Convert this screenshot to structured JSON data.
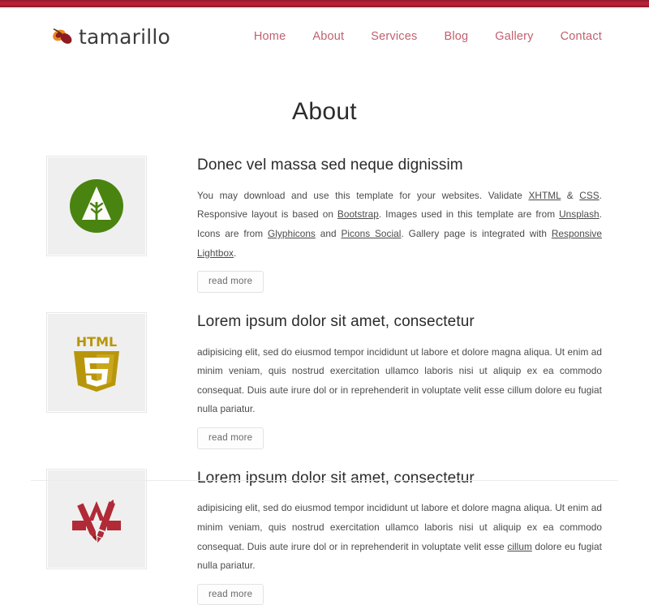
{
  "site": {
    "brand_name": "tamarillo",
    "brand_icon": "tamarillo-fruit-icon",
    "accent_color": "#c1606f",
    "topbar_color": "#a81e33",
    "background_color": "#ffffff"
  },
  "nav": {
    "items": [
      {
        "label": "Home",
        "active": false
      },
      {
        "label": "About",
        "active": true
      },
      {
        "label": "Services",
        "active": false
      },
      {
        "label": "Blog",
        "active": false
      },
      {
        "label": "Gallery",
        "active": false
      },
      {
        "label": "Contact",
        "active": false
      }
    ]
  },
  "page": {
    "title": "About"
  },
  "sections": [
    {
      "thumb_icon": "green-forest-tree-circle-icon",
      "heading": "Donec vel massa sed neque dignissim",
      "paragraph_parts": [
        {
          "text": "You may download and use this template for your websites. Validate ",
          "link": false
        },
        {
          "text": "XHTML",
          "link": true
        },
        {
          "text": " & ",
          "link": false
        },
        {
          "text": "CSS",
          "link": true
        },
        {
          "text": ". Responsive layout is based on ",
          "link": false
        },
        {
          "text": "Bootstrap",
          "link": true
        },
        {
          "text": ". Images used in this template are from ",
          "link": false
        },
        {
          "text": "Unsplash",
          "link": true
        },
        {
          "text": ". Icons are from ",
          "link": false
        },
        {
          "text": "Glyphicons",
          "link": true
        },
        {
          "text": " and ",
          "link": false
        },
        {
          "text": "Picons Social",
          "link": true
        },
        {
          "text": ". Gallery page is integrated with ",
          "link": false
        },
        {
          "text": "Responsive Lightbox",
          "link": true
        },
        {
          "text": ".",
          "link": false
        }
      ],
      "button_label": "read more"
    },
    {
      "thumb_icon": "html5-shield-icon",
      "heading": "Lorem ipsum dolor sit amet, consectetur",
      "paragraph_parts": [
        {
          "text": "adipisicing elit, sed do eiusmod tempor incididunt ut labore et dolore magna aliqua. Ut enim ad minim veniam, quis nostrud exercitation ullamco laboris nisi ut aliquip ex ea commodo consequat. Duis aute irure dol or in reprehenderit in voluptate velit esse cillum dolore eu fugiat nulla pariatur.",
          "link": false
        }
      ],
      "button_label": "read more"
    },
    {
      "thumb_icon": "appstore-pencil-brush-icon",
      "heading": "Lorem ipsum dolor sit amet, consectetur",
      "paragraph_parts": [
        {
          "text": "adipisicing elit, sed do eiusmod tempor incididunt ut labore et dolore magna aliqua. Ut enim ad minim veniam, quis nostrud exercitation ullamco laboris nisi ut aliquip ex ea commodo consequat. Duis aute irure dol or in reprehenderit in voluptate velit esse ",
          "link": false
        },
        {
          "text": "cillum",
          "link": true
        },
        {
          "text": " dolore eu fugiat nulla pariatur.",
          "link": false
        }
      ],
      "button_label": "read more"
    }
  ]
}
